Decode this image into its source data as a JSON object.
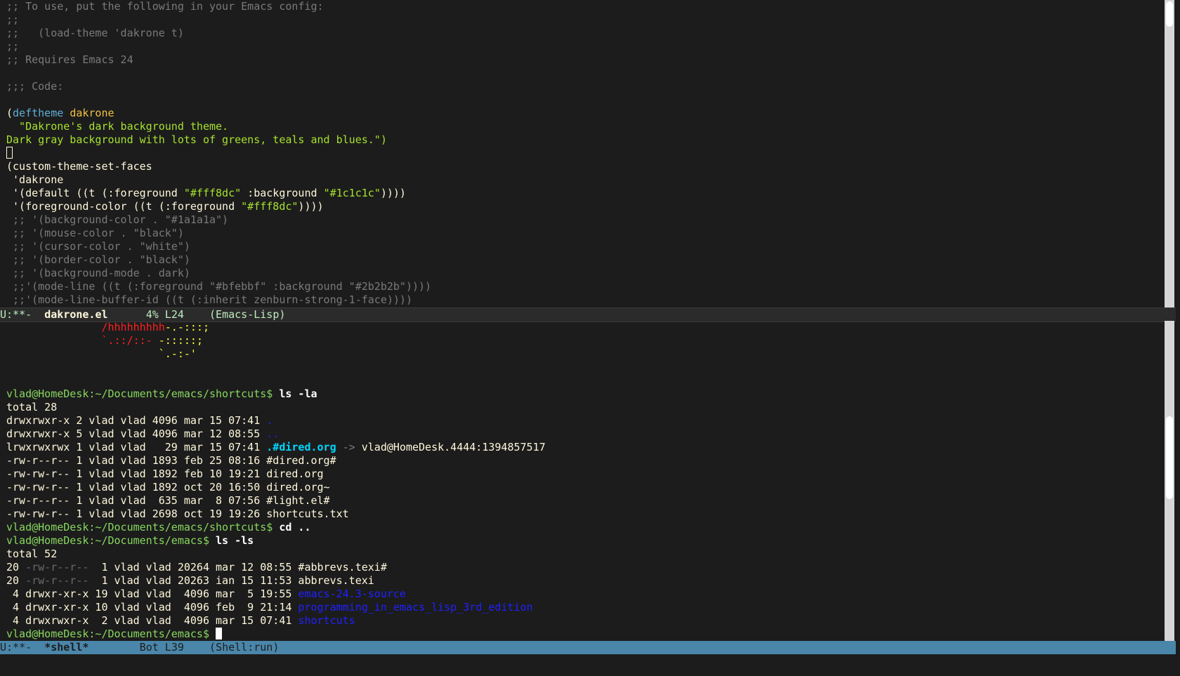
{
  "top_buffer": {
    "c1": ";; To use, put the following in your Emacs config:",
    "c2": ";;",
    "c3": ";;   (load-theme 'dakrone t)",
    "c4": ";;",
    "c5": ";; Requires Emacs 24",
    "c6": ";;; Code:",
    "deftheme_open": "(",
    "deftheme_kw": "deftheme",
    "deftheme_name": "dakrone",
    "doc1": "  \"Dakrone's dark background theme.",
    "doc2": "Dark gray background with lots of greens, teals and blues.\")",
    "csf": "(custom-theme-set-faces",
    "csf_arg": " 'dakrone",
    "d1a": " '(default ((t (:foreground ",
    "d1b": "\"#fff8dc\"",
    "d1c": " :background ",
    "d1d": "\"#1c1c1c\"",
    "d1e": "))))",
    "d2a": " '(foreground-color ((t (:foreground ",
    "d2b": "\"#fff8dc\"",
    "d2c": "))))",
    "k1": " ;; '(background-color . \"#1a1a1a\")",
    "k2": " ;; '(mouse-color . \"black\")",
    "k3": " ;; '(cursor-color . \"white\")",
    "k4": " ;; '(border-color . \"black\")",
    "k5": " ;; '(background-mode . dark)",
    "k6": " ;;'(mode-line ((t (:foreground \"#bfebbf\" :background \"#2b2b2b\"))))",
    "k7": " ;;'(mode-line-buffer-id ((t (:inherit zenburn-strong-1-face))))"
  },
  "modeline_top": {
    "status": "U:**-  ",
    "buffer": "dakrone.el",
    "pos": "      4% L24    ",
    "mode": "(Emacs-Lisp)"
  },
  "bottom_buffer": {
    "art1a": "               ",
    "art1b": "/hhhhhhhhh",
    "art1c": "-.-:::;",
    "art2a": "               ",
    "art2b": "`.::/::-",
    "art2c": " -:::::;",
    "art3a": "                        ",
    "art3b": "`.-:-'",
    "prompt1": "vlad@HomeDesk:~/Documents/emacs/shortcuts$ ",
    "cmd1": "ls -la",
    "total1": "total 28",
    "ls1_1a": "drwxrwxr-x 2 vlad vlad 4096 mar 15 07:41 ",
    "ls1_1b": ".",
    "ls1_2a": "drwxrwxr-x 5 vlad vlad 4096 mar 12 08:55 ",
    "ls1_2b": "..",
    "ls1_3a": "lrwxrwxrwx 1 vlad vlad   29 mar 15 07:41 ",
    "ls1_3b": ".#dired.org",
    "ls1_3c": " -> ",
    "ls1_3d": "vlad@HomeDesk.4444:1394857517",
    "ls1_4": "-rw-r--r-- 1 vlad vlad 1893 feb 25 08:16 #dired.org#",
    "ls1_5": "-rw-rw-r-- 1 vlad vlad 1892 feb 10 19:21 dired.org",
    "ls1_6": "-rw-rw-r-- 1 vlad vlad 1892 oct 20 16:50 dired.org~",
    "ls1_7": "-rw-r--r-- 1 vlad vlad  635 mar  8 07:56 #light.el#",
    "ls1_8": "-rw-rw-r-- 1 vlad vlad 2698 oct 19 19:26 shortcuts.txt",
    "prompt2": "vlad@HomeDesk:~/Documents/emacs/shortcuts$ ",
    "cmd2": "cd ..",
    "prompt3": "vlad@HomeDesk:~/Documents/emacs$ ",
    "cmd3": "ls -ls",
    "total2": "total 52",
    "ls2_1a": "20 ",
    "ls2_1b": "-rw-r--r--",
    "ls2_1c": "  1 vlad vlad 20264 mar 12 08:55 #abbrevs.texi#",
    "ls2_2a": "20 ",
    "ls2_2b": "-rw-r--r--",
    "ls2_2c": "  1 vlad vlad 20263 ian 15 11:53 abbrevs.texi",
    "ls2_3a": " 4 drwxr-xr-x 19 vlad vlad  4096 mar  5 19:55 ",
    "ls2_3b": "emacs-24.3-source",
    "ls2_4a": " 4 drwxr-xr-x 10 vlad vlad  4096 feb  9 21:14 ",
    "ls2_4b": "programming_in_emacs_lisp_3rd_edition",
    "ls2_5a": " 4 drwxrwxr-x  2 vlad vlad  4096 mar 15 07:41 ",
    "ls2_5b": "shortcuts",
    "prompt4": "vlad@HomeDesk:~/Documents/emacs$ "
  },
  "modeline_bottom": {
    "status": "U:**-  ",
    "buffer": "*shell*",
    "pos": "        Bot L39    ",
    "mode": "(Shell:run)"
  },
  "colors": {
    "background": "#1c1c1c",
    "foreground": "#fff8dc",
    "modeline_active": "#4a86aa",
    "modeline_inactive": "#2b2b2b"
  }
}
